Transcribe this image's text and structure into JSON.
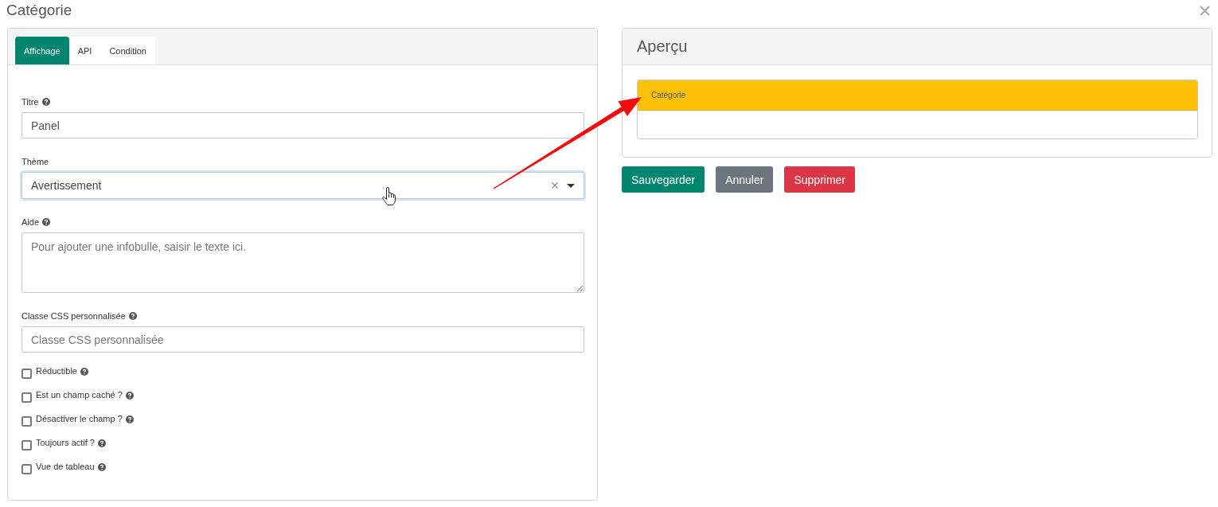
{
  "dialog": {
    "title": "Catégorie"
  },
  "settings_card": {
    "tabs": [
      {
        "label": "Affichage",
        "selected": true
      },
      {
        "label": "API",
        "selected": false
      },
      {
        "label": "Condition",
        "selected": false
      }
    ],
    "fields": [
      {
        "kind": "text",
        "label": "Titre",
        "help": true,
        "value": "Panel",
        "focused": false,
        "hovered": false
      },
      {
        "kind": "select",
        "label": "Thème",
        "help": false,
        "value": "Avertissement",
        "focused": true,
        "hovered": true
      },
      {
        "kind": "textarea",
        "label": "Aide",
        "help": true,
        "placeholder": "Pour ajouter une infobulle, saisir le texte ici.",
        "focused": false,
        "hovered": false
      },
      {
        "kind": "text",
        "label": "Classe CSS personnalisée",
        "help": true,
        "placeholder": "Classe CSS personnalisée",
        "focused": false,
        "hovered": false
      }
    ],
    "checkboxes": [
      {
        "label": "Réductible",
        "help": true,
        "checked": false
      },
      {
        "label": "Est un champ caché ?",
        "help": true,
        "checked": false
      },
      {
        "label": "Désactiver le champ ?",
        "help": true,
        "checked": false
      },
      {
        "label": "Toujours actif ?",
        "help": true,
        "checked": false
      },
      {
        "label": "Vue de tableau",
        "help": true,
        "checked": false
      }
    ]
  },
  "preview_card": {
    "title": "Aperçu",
    "panel": {
      "heading": "Catégorie"
    }
  },
  "buttons": [
    {
      "label": "Sauvegarder",
      "kind": "primary"
    },
    {
      "label": "Annuler",
      "kind": "secondary"
    },
    {
      "label": "Supprimer",
      "kind": "danger"
    }
  ]
}
